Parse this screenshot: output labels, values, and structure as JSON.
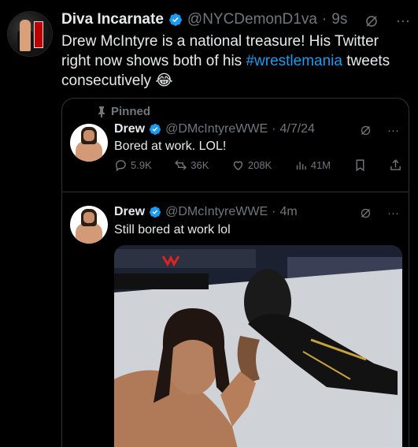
{
  "post": {
    "author_name": "Diva Incarnate",
    "handle": "@NYCDemonD1va",
    "separator": "·",
    "time": "9s",
    "text_before": "Drew McIntyre is a national treasure! His Twitter right now shows both of his ",
    "hashtag": "#wrestlemania",
    "text_after": " tweets consecutively 😂"
  },
  "quote": {
    "pinned_label": "Pinned",
    "tweet1": {
      "author_name": "Drew",
      "handle": "@DMcIntyreWWE",
      "separator": "·",
      "date": "4/7/24",
      "text": "Bored at work. LOL!",
      "replies": "5.9K",
      "reposts": "36K",
      "likes": "208K",
      "views": "41M"
    },
    "tweet2": {
      "author_name": "Drew",
      "handle": "@DMcIntyreWWE",
      "separator": "·",
      "time": "4m",
      "text": "Still bored at work lol"
    }
  },
  "colors": {
    "background": "#000000",
    "text": "#e7e9ea",
    "muted": "#71767b",
    "accent": "#1d9bf0",
    "border": "#2f3336"
  },
  "icons": [
    "verified-badge-icon",
    "grok-icon",
    "more-icon",
    "pin-icon",
    "reply-icon",
    "repost-icon",
    "like-icon",
    "views-icon",
    "bookmark-icon",
    "share-icon"
  ]
}
